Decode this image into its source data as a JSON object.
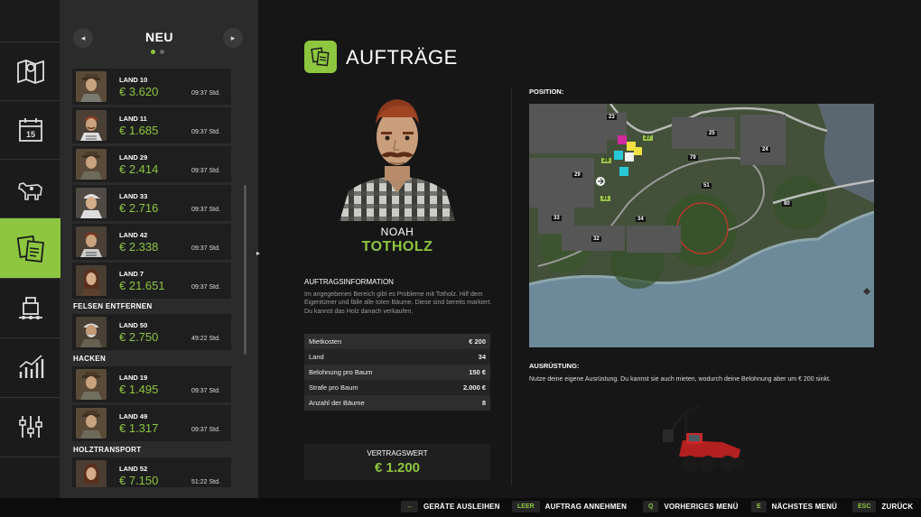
{
  "list": {
    "title": "NEU",
    "prev_icon": "◂",
    "next_icon": "▸",
    "groups": [
      {
        "header": "",
        "contracts": [
          {
            "land": "LAND 10",
            "price": "€ 3.620",
            "time": "09:37 Std."
          },
          {
            "land": "LAND 11",
            "price": "€ 1.685",
            "time": "09:37 Std."
          },
          {
            "land": "LAND 29",
            "price": "€ 2.414",
            "time": "09:37 Std."
          },
          {
            "land": "LAND 33",
            "price": "€ 2.716",
            "time": "09:37 Std."
          },
          {
            "land": "LAND 42",
            "price": "€ 2.338",
            "time": "09:37 Std."
          },
          {
            "land": "LAND 7",
            "price": "€ 21.651",
            "time": "09:37 Std."
          }
        ]
      },
      {
        "header": "FELSEN ENTFERNEN",
        "contracts": [
          {
            "land": "LAND 50",
            "price": "€ 2.750",
            "time": "49:22 Std."
          }
        ]
      },
      {
        "header": "HACKEN",
        "contracts": [
          {
            "land": "LAND 19",
            "price": "€ 1.495",
            "time": "09:37 Std."
          },
          {
            "land": "LAND 49",
            "price": "€ 1.317",
            "time": "09:37 Std."
          }
        ]
      },
      {
        "header": "HOLZTRANSPORT",
        "contracts": [
          {
            "land": "LAND 52",
            "price": "€ 7.150",
            "time": "51:22 Std."
          }
        ]
      }
    ]
  },
  "page": {
    "title": "AUFTRÄGE"
  },
  "contract": {
    "npc_name": "NOAH",
    "type": "TOTHOLZ",
    "info_heading": "AUFTRAGSINFORMATION",
    "info_text": "Im angegebenen Bereich gibt es Probleme mit Totholz. Hilf dem Eigentümer und fälle alle toten Bäume. Diese sind bereits markiert. Du kannst das Holz danach verkaufen.",
    "stats": [
      {
        "label": "Mietkosten",
        "value": "€ 200"
      },
      {
        "label": "Land",
        "value": "34"
      },
      {
        "label": "Belohnung pro Baum",
        "value": "150 €"
      },
      {
        "label": "Strafe pro Baum",
        "value": "2.000 €"
      },
      {
        "label": "Anzahl der Bäume",
        "value": "8"
      }
    ],
    "value_label": "VERTRAGSWERT",
    "value": "€ 1.200"
  },
  "position": {
    "label": "POSITION:",
    "map_labels": [
      "23",
      "25",
      "27",
      "24",
      "79",
      "28",
      "29",
      "51",
      "31",
      "34",
      "80",
      "33",
      "32"
    ]
  },
  "equipment": {
    "heading": "AUSRÜSTUNG:",
    "text": "Nutze deine eigene Ausrüstung. Du kannst sie auch mieten, wodurch deine Belohnung aber um € 200 sinkt."
  },
  "bottom_bar": [
    {
      "key": "↔",
      "label": "GERÄTE AUSLEIHEN"
    },
    {
      "key": "LEER",
      "label": "AUFTRAG ANNEHMEN"
    },
    {
      "key": "Q",
      "label": "VORHERIGES MENÜ"
    },
    {
      "key": "E",
      "label": "NÄCHSTES MENÜ"
    },
    {
      "key": "ESC",
      "label": "ZURÜCK"
    }
  ],
  "colors": {
    "accent": "#8dc63f",
    "panel": "#2b2b2b",
    "background": "#161616"
  },
  "nav_icons": [
    "map-icon",
    "calendar-icon",
    "animals-icon",
    "contracts-icon",
    "production-icon",
    "statistics-icon",
    "settings-icon"
  ],
  "calendar_day": "15"
}
